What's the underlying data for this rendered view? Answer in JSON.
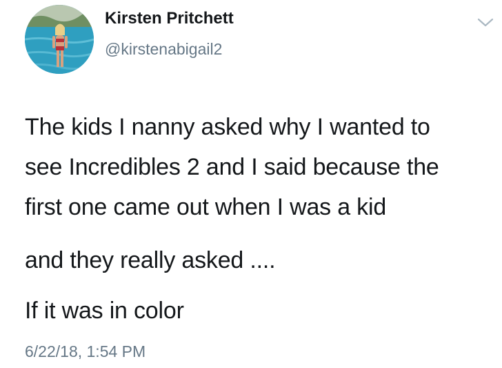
{
  "tweet": {
    "author": {
      "display_name": "Kirsten Pritchett",
      "handle": "@kirstenabigail2",
      "avatar_icon": "profile-photo"
    },
    "menu_icon": "chevron-down-icon",
    "text_lines": [
      "The kids I nanny asked why I wanted to",
      "see Incredibles 2 and I said because the",
      "first one came out when I was a kid",
      "and they really asked ....",
      "If it was in color"
    ],
    "timestamp": "6/22/18, 1:54 PM"
  },
  "colors": {
    "text_primary": "#14171a",
    "text_secondary": "#657786",
    "background": "#ffffff"
  }
}
